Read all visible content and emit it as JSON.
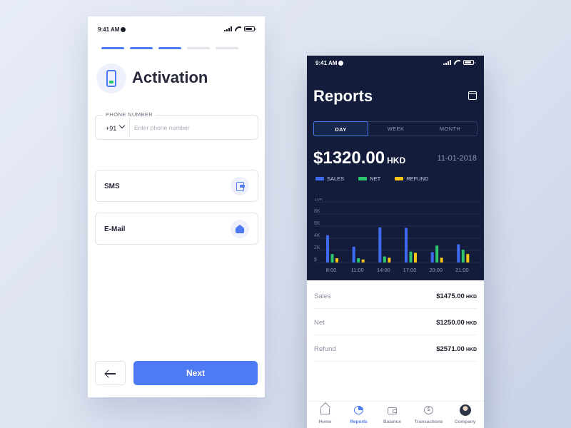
{
  "activation": {
    "status_time": "9:41 AM",
    "steps": [
      true,
      true,
      true,
      false,
      false
    ],
    "title": "Activation",
    "phone_field": {
      "label": "PHONE NUMBER",
      "country_code": "+91",
      "placeholder": "Enter phone number",
      "value": ""
    },
    "options": [
      {
        "label": "SMS",
        "icon": "sms-icon"
      },
      {
        "label": "E-Mail",
        "icon": "mail-icon"
      }
    ],
    "next_label": "Next",
    "back_icon": "arrow-left-icon"
  },
  "reports": {
    "status_time": "9:41 AM",
    "title": "Reports",
    "tabs": [
      {
        "label": "DAY",
        "active": true
      },
      {
        "label": "WEEK",
        "active": false
      },
      {
        "label": "MONTH",
        "active": false
      }
    ],
    "amount": "$1320.00",
    "currency": "HKD",
    "date": "11-01-2018",
    "legend": [
      {
        "label": "SALES",
        "color": "#3f6bf0"
      },
      {
        "label": "NET",
        "color": "#2dc56e"
      },
      {
        "label": "REFUND",
        "color": "#f5c417"
      }
    ],
    "summary": [
      {
        "label": "Sales",
        "value": "$1475.00",
        "unit": "HKD"
      },
      {
        "label": "Net",
        "value": "$1250.00",
        "unit": "HKD"
      },
      {
        "label": "Refund",
        "value": "$2571.00",
        "unit": "HKD"
      }
    ],
    "tabbar": [
      {
        "label": "Home",
        "icon": "home-icon",
        "active": false
      },
      {
        "label": "Reports",
        "icon": "pie-chart-icon",
        "active": true
      },
      {
        "label": "Balance",
        "icon": "wallet-icon",
        "active": false
      },
      {
        "label": "Transactions",
        "icon": "dollar-coin-icon",
        "active": false
      },
      {
        "label": "Company",
        "icon": "avatar-icon",
        "active": false
      }
    ]
  },
  "chart_data": {
    "type": "bar",
    "categories": [
      "8:00",
      "11:00",
      "14:00",
      "17:00",
      "20:00",
      "21:00"
    ],
    "y_ticks": [
      "$",
      "2K",
      "4K",
      "6K",
      "8K",
      "10K"
    ],
    "ylim": [
      0,
      10000
    ],
    "grid": true,
    "legend_position": "top-left",
    "series": [
      {
        "name": "SALES",
        "color": "#3f6bf0",
        "values": [
          4500,
          2600,
          5800,
          5700,
          1700,
          3000
        ]
      },
      {
        "name": "NET",
        "color": "#2dc56e",
        "values": [
          1400,
          700,
          1000,
          1800,
          2800,
          2100
        ]
      },
      {
        "name": "REFUND",
        "color": "#f5c417",
        "values": [
          700,
          500,
          800,
          1600,
          800,
          1400
        ]
      }
    ]
  }
}
